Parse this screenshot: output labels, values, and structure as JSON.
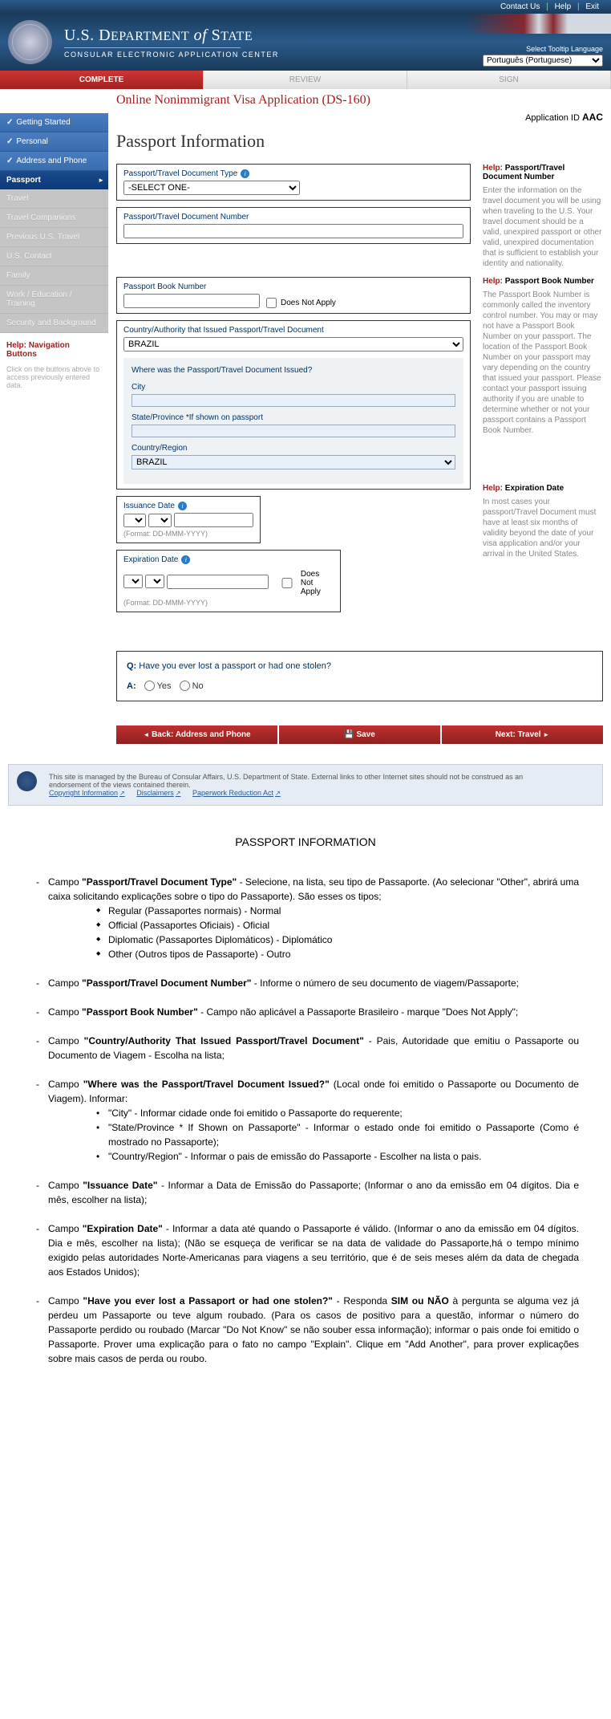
{
  "topLinks": {
    "contact": "Contact Us",
    "help": "Help",
    "exit": "Exit"
  },
  "langLabel": "Select Tooltip Language",
  "langValue": "Português (Portuguese)",
  "header": {
    "title1": "U.S. D",
    "title2": "EPARTMENT",
    "title3": "of",
    "title4": " S",
    "title5": "TATE",
    "subtitle": "CONSULAR ELECTRONIC APPLICATION CENTER"
  },
  "tabs": {
    "complete": "COMPLETE",
    "review": "REVIEW",
    "sign": "SIGN"
  },
  "nav": {
    "getting": "Getting Started",
    "personal": "Personal",
    "address": "Address and Phone",
    "passport": "Passport",
    "travel": "Travel",
    "companions": "Travel Companions",
    "previous": "Previous U.S. Travel",
    "contact": "U.S. Contact",
    "family": "Family",
    "work": "Work / Education / Training",
    "security": "Security and Background"
  },
  "sideHelp": {
    "hdr": "Help: Navigation Buttons",
    "txt": "Click on the buttons above to access previously entered data."
  },
  "appTitle": "Online Nonimmigrant Visa Application (DS-160)",
  "appIdLabel": "Application ID",
  "appIdValue": "AAC",
  "pageTitle": "Passport Information",
  "fields": {
    "docType": "Passport/Travel Document Type",
    "docTypeVal": "-SELECT ONE-",
    "docNumber": "Passport/Travel Document Number",
    "bookNumber": "Passport Book Number",
    "dna": "Does Not Apply",
    "issuedBy": "Country/Authority that Issued Passport/Travel Document",
    "brazil": "BRAZIL",
    "whereIssued": "Where was the Passport/Travel Document Issued?",
    "city": "City",
    "state": "State/Province *If shown on passport",
    "country": "Country/Region",
    "issuance": "Issuance Date",
    "expiration": "Expiration Date",
    "format": "(Format: DD-MMM-YYYY)"
  },
  "helpBlocks": {
    "docNumber": {
      "hdr": "Help:",
      "title": "Passport/Travel Document Number",
      "body": "Enter the information on the travel document you will be using when traveling to the U.S. Your travel document should be a valid, unexpired passport or other valid, unexpired documentation that is sufficient to establish your identity and nationality."
    },
    "bookNumber": {
      "hdr": "Help:",
      "title": "Passport Book Number",
      "body": "The Passport Book Number is commonly called the inventory control number. You may or may not have a Passport Book Number on your passport. The location of the Passport Book Number on your passport may vary depending on the country that issued your passport. Please contact your passport issuing authority if you are unable to determine whether or not your passport contains a Passport Book Number."
    },
    "expiration": {
      "hdr": "Help:",
      "title": "Expiration Date",
      "body": "In most cases your passport/Travel Document must have at least six months of validity beyond the date of your visa application and/or your arrival in the United States."
    }
  },
  "question": {
    "q": "Have you ever lost a passport or had one stolen?",
    "yes": "Yes",
    "no": "No"
  },
  "btns": {
    "back": "Back: Address and Phone",
    "save": "Save",
    "next": "Next: Travel"
  },
  "footer": {
    "text": "This site is managed by the Bureau of Consular Affairs, U.S. Department of State. External links to other Internet sites should not be construed as an endorsement of the views contained therein.",
    "copyright": "Copyright Information",
    "disclaimers": "Disclaimers",
    "paperwork": "Paperwork Reduction Act"
  },
  "instHdr": "PASSPORT INFORMATION",
  "inst": {
    "i1a": "Campo ",
    "i1b": "\"Passport/Travel Document Type\"",
    "i1c": " - Selecione, na lista, seu tipo de Passaporte. (Ao selecionar \"Other\", abrirá uma caixa solicitando explicações sobre o tipo do Passaporte). São esses os tipos;",
    "i1s1": "Regular (Passaportes normais)        -        Normal",
    "i1s2": "Official (Passaportes Oficiais)           -        Oficial",
    "i1s3": "Diplomatic (Passaportes Diplomáticos)   -      Diplomático",
    "i1s4": "Other (Outros tipos de Passaporte)          -            Outro",
    "i2a": "Campo ",
    "i2b": "\"Passport/Travel Document Number\"",
    "i2c": " - Informe o número de seu documento de viagem/Passaporte;",
    "i3a": "Campo ",
    "i3b": "\"Passport Book Number\"",
    "i3c": " - Campo não aplicável a Passaporte Brasileiro - marque \"Does Not Apply\";",
    "i4a": "Campo ",
    "i4b": "\"Country/Authority That Issued Passport/Travel Document\"",
    "i4c": " - Pais, Autoridade que emitiu o Passaporte ou Documento de Viagem - Escolha na lista;",
    "i5a": "Campo ",
    "i5b": "\"Where was the Passport/Travel Document Issued?\"",
    "i5c": " (Local onde foi emitido o Passaporte ou Documento de Viagem). Informar:",
    "i5s1": "\"City\" - Informar cidade onde foi emitido o Passaporte do requerente;",
    "i5s2": "\"State/Province * If Shown on Passaporte\" - Informar o estado onde foi emitido o Passaporte (Como é mostrado no Passaporte);",
    "i5s3": "\"Country/Region\" - Informar o pais de emissão do Passaporte - Escolher na lista o pais.",
    "i6a": "Campo ",
    "i6b": "\"Issuance Date\"",
    "i6c": " - Informar a Data de Emissão do Passaporte; (Informar o ano da emissão em 04 dígitos. Dia e mês, escolher na lista);",
    "i7a": "Campo ",
    "i7b": "\"Expiration Date\"",
    "i7c": " - Informar a data até quando o Passaporte é válido. (Informar o ano da emissão em 04 dígitos. Dia e mês, escolher na lista); (Não se esqueça de verificar se na data de validade do Passaporte,há o tempo mínimo exigido pelas autoridades Norte-Americanas para viagens a seu território, que é de seis meses além da data de chegada aos Estados Unidos);",
    "i8a": "Campo ",
    "i8b": "\"Have you ever lost a Passaport or had one stolen?\"",
    "i8c": " - Responda ",
    "i8d": "SIM ou NÃO",
    "i8e": " à pergunta se alguma vez já perdeu um Passaporte ou teve algum roubado. (Para os casos de positivo para a questão, informar o número do Passaporte perdido ou roubado (Marcar \"Do Not Know\" se não souber essa informação); informar o pais onde foi emitido o Passaporte. Prover uma explicação para o fato no campo \"Explain\". Clique em \"Add Another\", para prover explicações sobre mais casos de perda ou roubo."
  }
}
